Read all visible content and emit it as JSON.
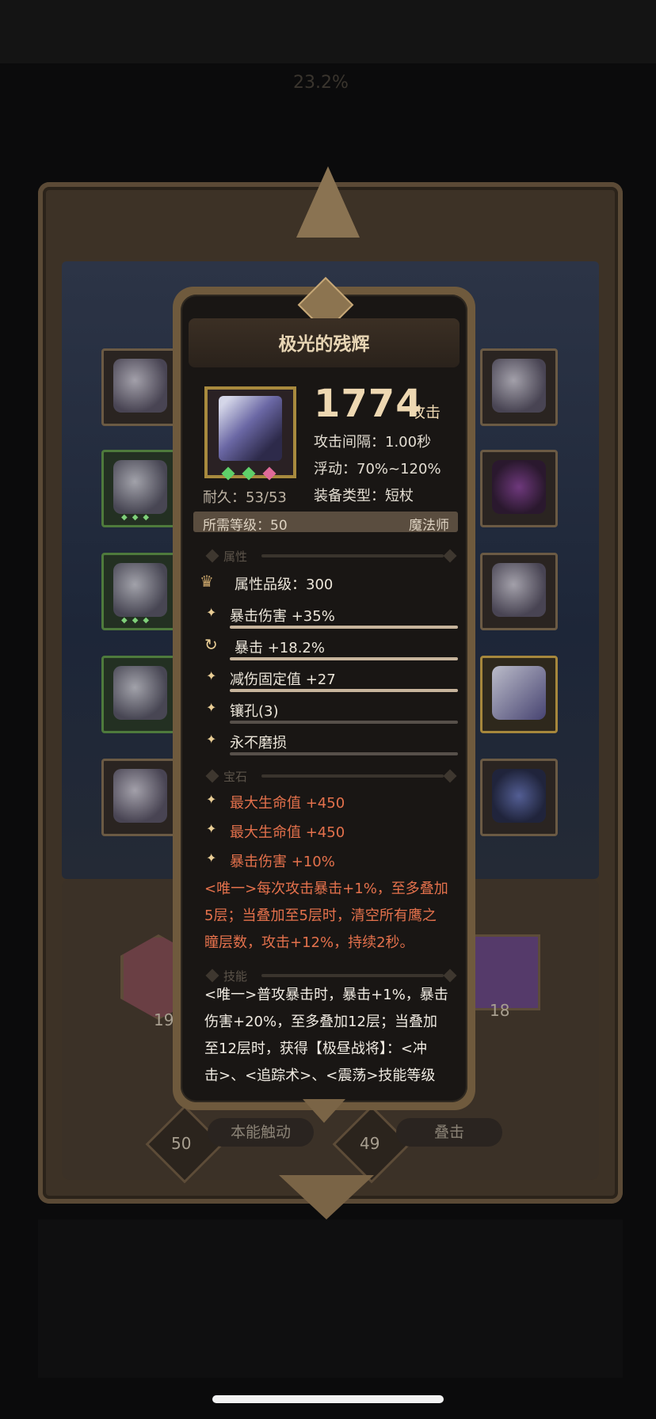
{
  "background": {
    "faint_header": "23.2%",
    "bottom_left_label": "本能触动",
    "bottom_right_label": "叠击",
    "bottom_left_level": "50",
    "bottom_right_level": "49",
    "portrait_left_level": "19",
    "portrait_right_level": "18"
  },
  "tooltip": {
    "title": "极光的残辉",
    "attack_value": "1774",
    "attack_label": "攻击",
    "attack_interval_label": "攻击间隔：",
    "attack_interval_value": "1.00秒",
    "float_label": "浮动：",
    "float_value": "70%~120%",
    "equip_type_label": "装备类型：",
    "equip_type_value": "短杖",
    "durability_label": "耐久：",
    "durability_value": "53/53",
    "required_level_label": "所需等级：50",
    "class_label": "魔法师",
    "attributes_header": "属性",
    "attribute_grade": "属性品级：300",
    "attributes": [
      {
        "text": "暴击伤害 +35%",
        "icon": "spark-icon"
      },
      {
        "text": "暴击 +18.2%",
        "icon": "cycle-icon"
      },
      {
        "text": "减伤固定值 +27",
        "icon": "spark-icon"
      },
      {
        "text": "镶孔(3)",
        "icon": "spark-icon"
      },
      {
        "text": "永不磨损",
        "icon": "spark-icon"
      }
    ],
    "gems_header": "宝石",
    "gems": [
      "最大生命值 +450",
      "最大生命值 +450",
      "暴击伤害 +10%"
    ],
    "unique_effect_lines": [
      "<唯一>每次攻击暴击+1%，至多叠加",
      "5层；当叠加至5层时，清空所有鹰之",
      "瞳层数，攻击+12%，持续2秒。"
    ],
    "skills_header": "技能",
    "skill_lines": [
      "<唯一>普攻暴击时，暴击+1%，暴击",
      "伤害+20%，至多叠加12层；当叠加",
      "至12层时，获得【极昼战将】：<冲",
      "击>、<追踪术>、<震荡>技能等级"
    ]
  },
  "colors": {
    "accent_gold": "#a88a3e",
    "gem_red_text": "#e4714c",
    "panel_bg": "#191614"
  }
}
